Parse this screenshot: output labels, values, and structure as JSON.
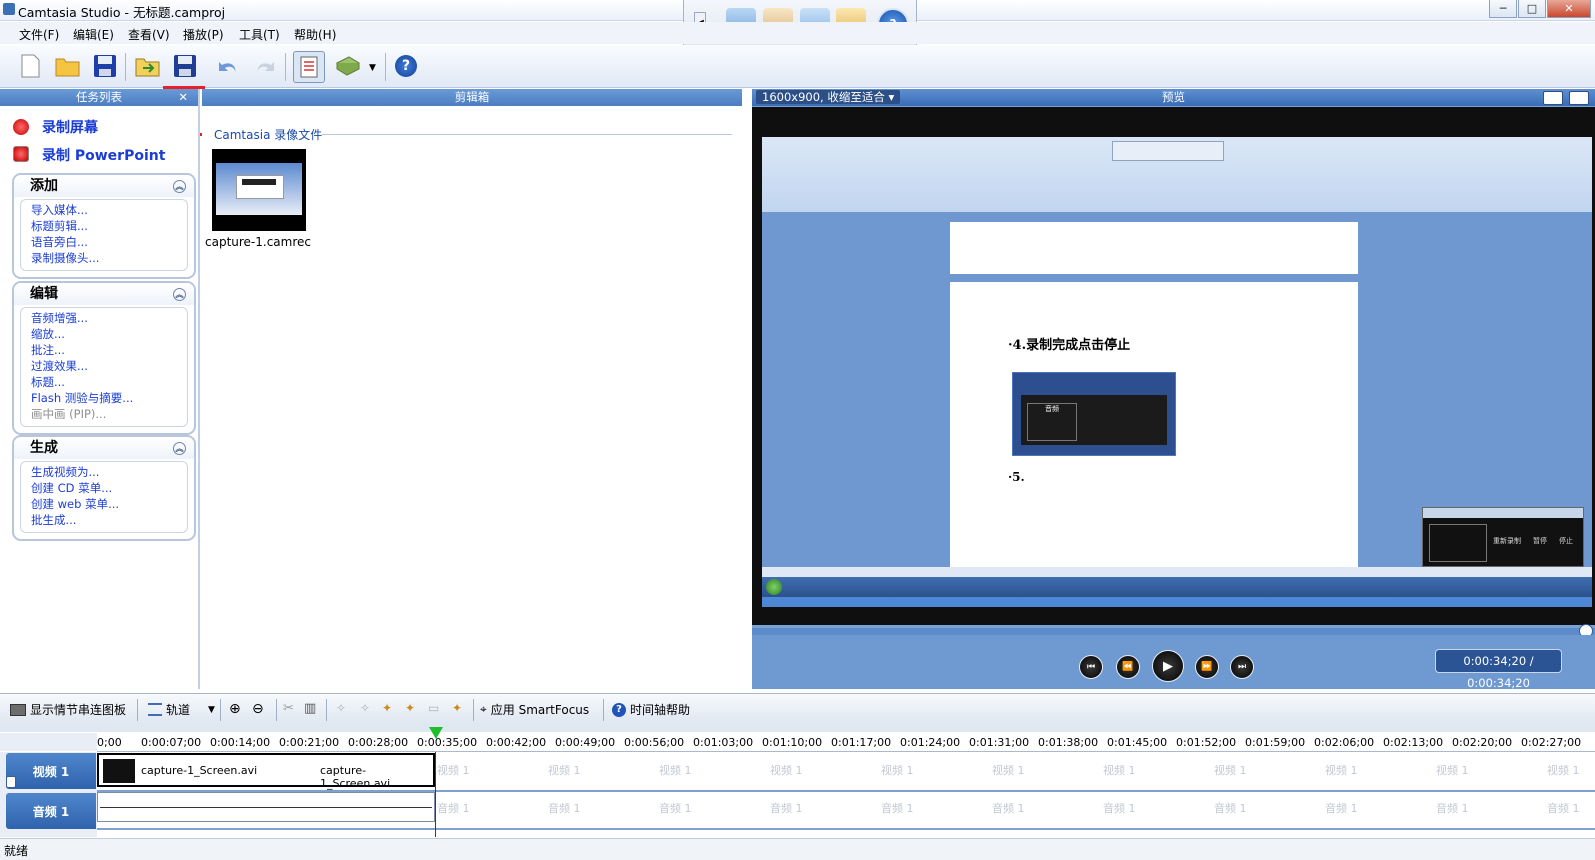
{
  "window": {
    "title": "Camtasia Studio - 无标题.camproj",
    "min_label": "─",
    "max_label": "□",
    "close_label": "✕"
  },
  "menu": [
    "文件(F)",
    "编辑(E)",
    "查看(V)",
    "播放(P)",
    "工具(T)",
    "帮助(H)"
  ],
  "toolbar_icons": [
    "new-icon",
    "open-folder-icon",
    "save-icon",
    "import-icon",
    "save-as-icon",
    "undo-icon",
    "redo-icon",
    "task-list-icon",
    "clip-bin-icon",
    "help-icon"
  ],
  "task_panel": {
    "title": "任务列表",
    "close": "✕",
    "record_screen": "录制屏幕",
    "record_ppt": "录制 PowerPoint",
    "groups": [
      {
        "title": "添加",
        "items": [
          "导入媒体...",
          "标题剪辑...",
          "语音旁白...",
          "录制摄像头..."
        ]
      },
      {
        "title": "编辑",
        "items": [
          "音频增强...",
          "缩放...",
          "批注...",
          "过渡效果...",
          "标题...",
          "Flash 测验与摘要...",
          "画中画 (PIP)..."
        ]
      },
      {
        "title": "生成",
        "items": [
          "生成视频为...",
          "创建 CD 菜单...",
          "创建 web 菜单...",
          "批生成..."
        ]
      }
    ]
  },
  "clip_bin": {
    "title": "剪辑箱",
    "section": "Camtasia 录像文件",
    "file": "capture-1.camrec"
  },
  "preview": {
    "title": "预览",
    "size_select": "1600x900, 收缩至适合",
    "doc_text_1": "·4.录制完成点击停止",
    "doc_text_2": "·5.",
    "time": "0:00:34;20 / 0:00:34;20",
    "recorder_title": "音频",
    "recorder_labels": [
      "重新录制",
      "暂停",
      "停止"
    ]
  },
  "timeline_toolbar": {
    "storyboard": "显示情节串连图板",
    "tracks": "轨道",
    "smartfocus": "应用 SmartFocus",
    "help": "时间轴帮助"
  },
  "ruler": [
    "0;00",
    "0:00:07;00",
    "0:00:14;00",
    "0:00:21;00",
    "0:00:28;00",
    "0:00:35;00",
    "0:00:42;00",
    "0:00:49;00",
    "0:00:56;00",
    "0:01:03;00",
    "0:01:10;00",
    "0:01:17;00",
    "0:01:24;00",
    "0:01:31;00",
    "0:01:38;00",
    "0:01:45;00",
    "0:01:52;00",
    "0:01:59;00",
    "0:02:06;00",
    "0:02:13;00",
    "0:02:20;00",
    "0:02:27;00"
  ],
  "tracks": {
    "video_label": "视频 1",
    "audio_label": "音频 1",
    "clip_a": "capture-1_Screen.avi",
    "clip_b": "capture-1_Screen.avi",
    "ghost_video": "视频 1",
    "ghost_audio": "音频 1"
  },
  "status": "就绪"
}
